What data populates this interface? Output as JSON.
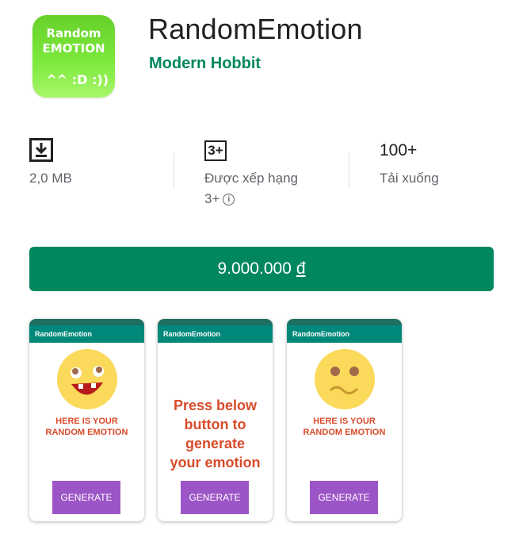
{
  "app": {
    "icon_text_line1": "Random",
    "icon_text_line2": "EMOTION",
    "icon_text_line3": "^^ :D :))",
    "title": "RandomEmotion",
    "developer": "Modern Hobbit"
  },
  "stats": {
    "size": "2,0 MB",
    "size_icon": "download-icon",
    "rating_badge": "3+",
    "rating_label": "Được xếp hạng",
    "rating_value": "3+",
    "downloads": "100+",
    "downloads_label": "Tải xuống"
  },
  "buy": {
    "price": "9.000.000",
    "currency": "đ"
  },
  "screenshots": [
    {
      "app_title": "RandomEmotion",
      "message_line1": "HERE IS YOUR",
      "message_line2": "RANDOM EMOTION",
      "button": "GENERATE",
      "face": "laughing"
    },
    {
      "app_title": "RandomEmotion",
      "message_line1": "Press below",
      "message_line2": "button to",
      "message_line3": "generate",
      "message_line4": "your emotion",
      "button": "GENERATE"
    },
    {
      "app_title": "RandomEmotion",
      "message_line1": "HERE IS YOUR",
      "message_line2": "RANDOM EMOTION",
      "button": "GENERATE",
      "face": "confused"
    }
  ],
  "colors": {
    "accent": "#01875f",
    "appbar": "#00897b",
    "button": "#9c55c6",
    "message": "#d84b2a",
    "face": "#fbd95a"
  }
}
